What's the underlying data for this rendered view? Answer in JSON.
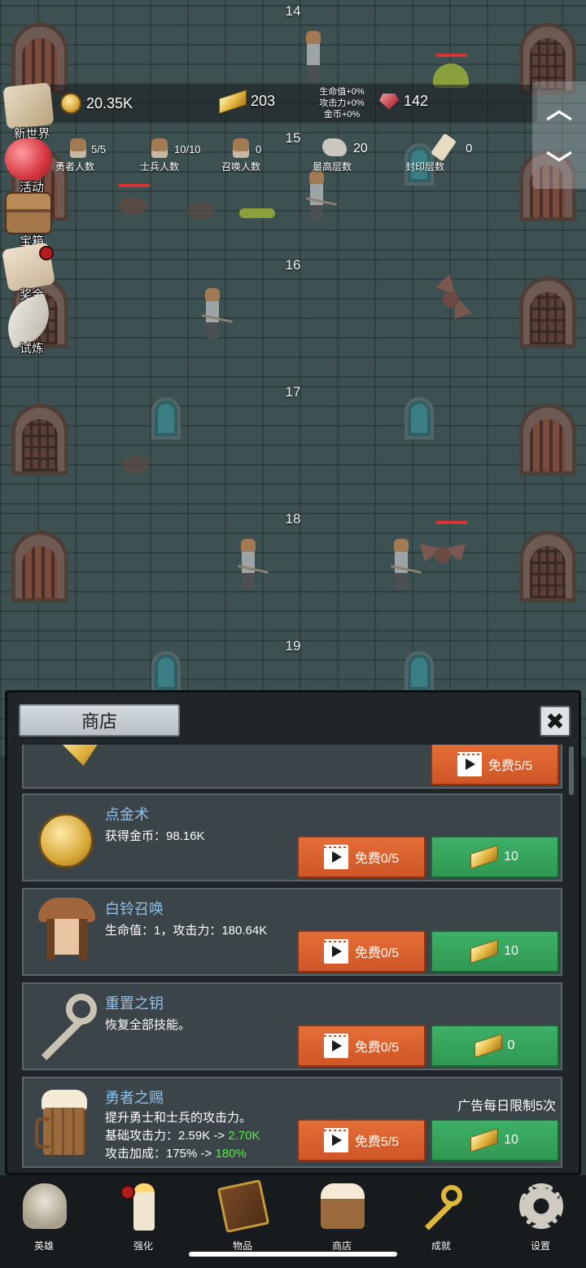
{
  "floors": [
    {
      "number": "14"
    },
    {
      "number": "15"
    },
    {
      "number": "16"
    },
    {
      "number": "17"
    },
    {
      "number": "18"
    },
    {
      "number": "19"
    }
  ],
  "hud": {
    "gold": "20.35K",
    "gold_bars": "203",
    "bonus": {
      "hp": "生命值+0%",
      "atk": "攻击力+0%",
      "coin": "金币+0%"
    },
    "gems": "142",
    "stats": [
      {
        "value": "5/5",
        "label": "勇者人数"
      },
      {
        "value": "10/10",
        "label": "士兵人数"
      },
      {
        "value": "0",
        "label": "召唤人数"
      },
      {
        "value": "20",
        "label": "最高层数"
      },
      {
        "value": "0",
        "label": "封印层数"
      }
    ],
    "scroll_up_icon": "chevron-up-icon",
    "scroll_down_icon": "chevron-down-icon"
  },
  "side_menu": [
    {
      "label": "新世界",
      "icon": "map-icon"
    },
    {
      "label": "活动",
      "icon": "heart-icon"
    },
    {
      "label": "宝箱",
      "icon": "chest-icon"
    },
    {
      "label": "奖金",
      "icon": "envelope-icon",
      "badge": true
    },
    {
      "label": "试炼",
      "icon": "feather-icon"
    }
  ],
  "shop": {
    "title": "商店",
    "close_icon": "close-icon",
    "items": [
      {
        "name": "",
        "free_label": "免费5/5"
      },
      {
        "name": "点金术",
        "desc": [
          "获得金币：98.16K"
        ],
        "free_label": "免费0/5",
        "cost": "10"
      },
      {
        "name": "白铃召唤",
        "desc": [
          "生命值：1，攻击力：180.64K"
        ],
        "free_label": "免费0/5",
        "cost": "10"
      },
      {
        "name": "重置之钥",
        "desc": [
          "恢复全部技能。"
        ],
        "free_label": "免费0/5",
        "cost": "0"
      },
      {
        "name": "勇者之赐",
        "limit": "广告每日限制5次",
        "desc_line1": "提升勇士和士兵的攻击力。",
        "desc_line2_prefix": "基础攻击力：2.59K -> ",
        "desc_line2_new": "2.70K",
        "desc_line3_prefix": "攻击加成：175% -> ",
        "desc_line3_new": "180%",
        "free_label": "免费5/5",
        "cost": "10"
      }
    ]
  },
  "bottom_nav": [
    {
      "label": "英雄",
      "icon": "skull-icon"
    },
    {
      "label": "强化",
      "icon": "candle-icon",
      "badge": true
    },
    {
      "label": "物品",
      "icon": "book-icon"
    },
    {
      "label": "商店",
      "icon": "beer-mug-icon"
    },
    {
      "label": "成就",
      "icon": "key-icon"
    },
    {
      "label": "设置",
      "icon": "gear-icon"
    }
  ],
  "colors": {
    "orange_button": "#d85e2c",
    "green_button": "#36a35c",
    "item_name": "#8fc1ea",
    "highlight": "#5bea4a"
  }
}
